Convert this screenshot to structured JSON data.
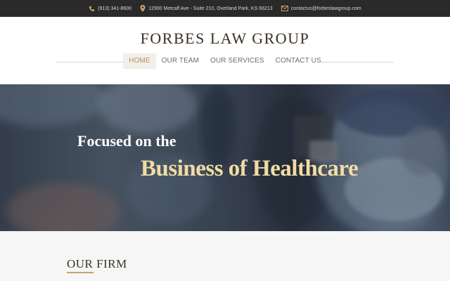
{
  "topbar": {
    "phone": "(913) 341-8600",
    "address": "12900 Metcalf Ave - Suite 210, Overland Park, KS 66213",
    "email": "contactus@forbeslawgroup.com",
    "icons": [
      "phone-icon",
      "map-pin-icon",
      "envelope-icon"
    ],
    "icon_color": "#c2a664"
  },
  "header": {
    "logo": "FORBES LAW GROUP"
  },
  "nav": {
    "items": [
      {
        "label": "HOME",
        "active": true
      },
      {
        "label": "OUR TEAM",
        "active": false
      },
      {
        "label": "OUR SERVICES",
        "active": false
      },
      {
        "label": "CONTACT US",
        "active": false
      }
    ]
  },
  "hero": {
    "line1": "Focused on the",
    "line2": "Business of Healthcare",
    "accent_color": "#f0dca3"
  },
  "firm": {
    "title": "OUR FIRM",
    "accent_color": "#c2a664"
  }
}
